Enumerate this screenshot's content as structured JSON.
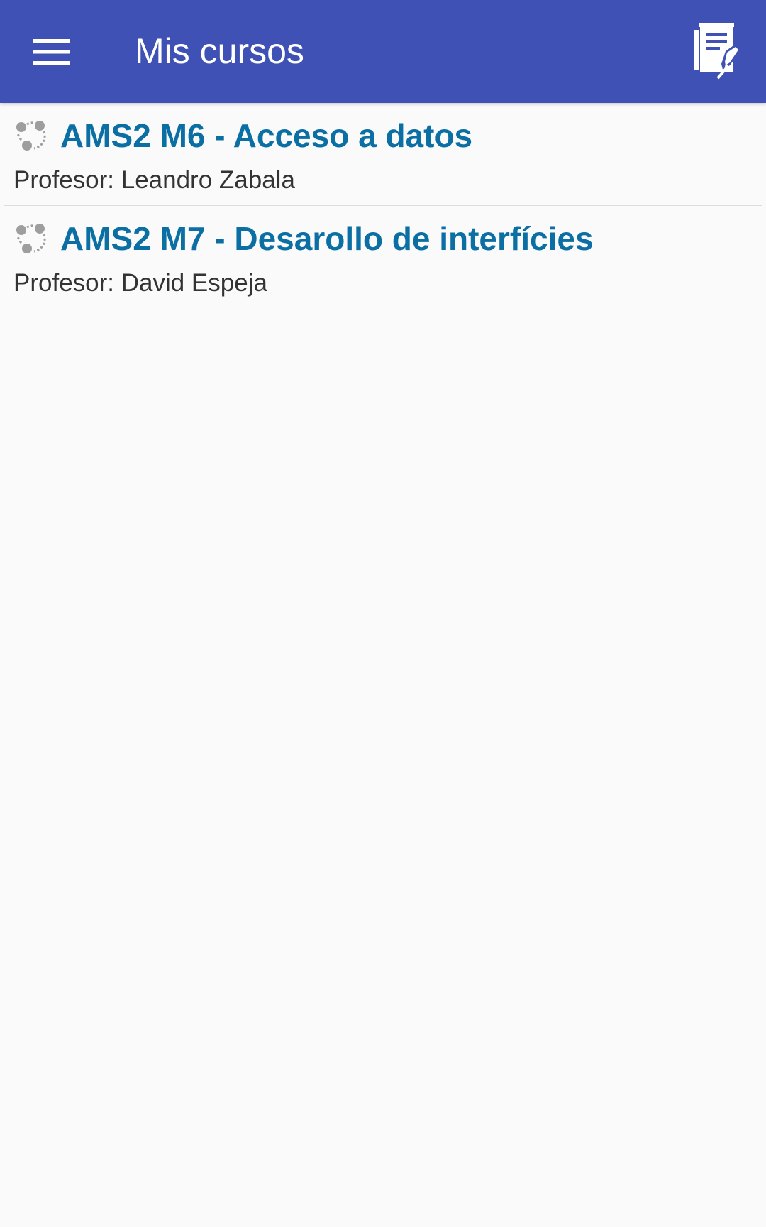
{
  "appbar": {
    "title": "Mis cursos",
    "background": "#3f51b5",
    "menu_icon": "hamburger-menu-icon",
    "action_icon": "notebook-edit-icon"
  },
  "courses": [
    {
      "icon": "course-dots-icon",
      "title": "AMS2 M6 - Acceso a datos",
      "teacher": "Profesor: Leandro Zabala"
    },
    {
      "icon": "course-dots-icon",
      "title": "AMS2 M7 - Desarollo de interfícies",
      "teacher": "Profesor: David Espeja"
    }
  ],
  "colors": {
    "course_title": "#0b6fa4",
    "teacher_text": "#333333",
    "page_background": "#fafafa",
    "divider": "#dddddd"
  }
}
